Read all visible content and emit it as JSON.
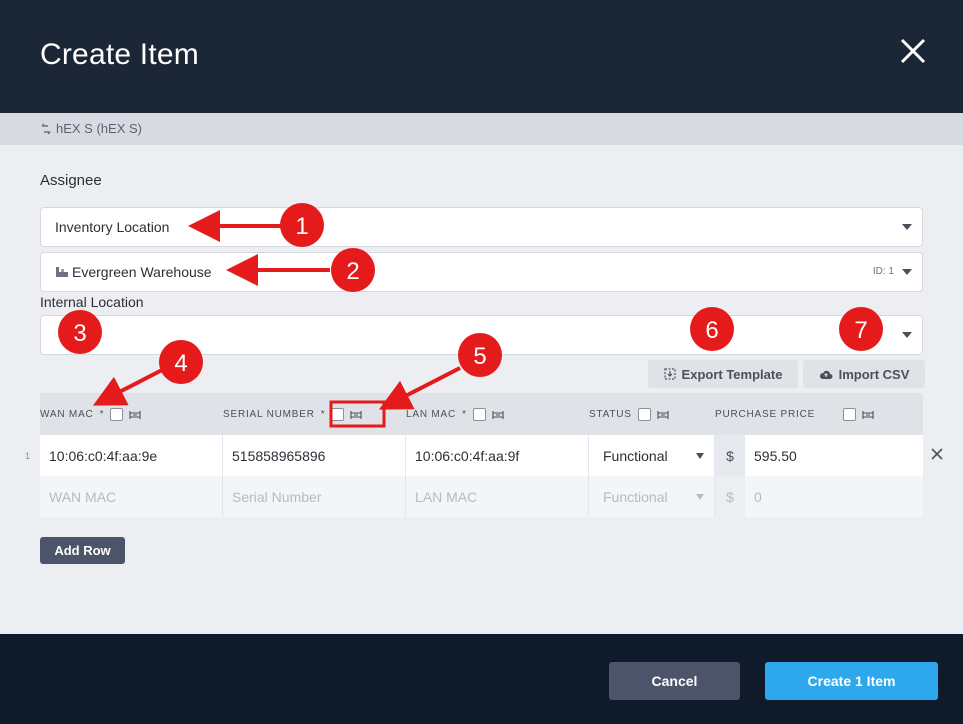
{
  "dialog": {
    "title": "Create Item",
    "model_label": "hEX S (hEX S)"
  },
  "assignee": {
    "label": "Assignee",
    "type_value": "Inventory Location",
    "location_value": "Evergreen Warehouse",
    "location_id": "ID: 1"
  },
  "internal_location": {
    "label": "Internal Location",
    "value": ""
  },
  "toolbar": {
    "export_label": "Export Template",
    "import_label": "Import CSV"
  },
  "table": {
    "columns": [
      {
        "label": "WAN MAC",
        "required": "*"
      },
      {
        "label": "SERIAL NUMBER",
        "required": "*"
      },
      {
        "label": "LAN MAC",
        "required": "*"
      },
      {
        "label": "STATUS",
        "required": ""
      },
      {
        "label": "PURCHASE PRICE",
        "required": ""
      }
    ],
    "rows": [
      {
        "index": "1",
        "wan_mac": "10:06:c0:4f:aa:9e",
        "serial": "515858965896",
        "lan_mac": "10:06:c0:4f:aa:9f",
        "status": "Functional",
        "currency": "$",
        "price": "595.50"
      }
    ],
    "new_row": {
      "wan_mac": "WAN MAC",
      "serial": "Serial Number",
      "lan_mac": "LAN MAC",
      "status": "Functional",
      "currency": "$",
      "price": "0"
    }
  },
  "actions": {
    "add_row_label": "Add Row",
    "cancel_label": "Cancel",
    "create_label": "Create 1 Item"
  },
  "annotations": [
    "1",
    "2",
    "3",
    "4",
    "5",
    "6",
    "7"
  ],
  "colors": {
    "header_bg": "#1b2636",
    "footer_bg": "#0f1a2a",
    "primary": "#2ea8ec",
    "annotation_red": "#e51a1a"
  }
}
